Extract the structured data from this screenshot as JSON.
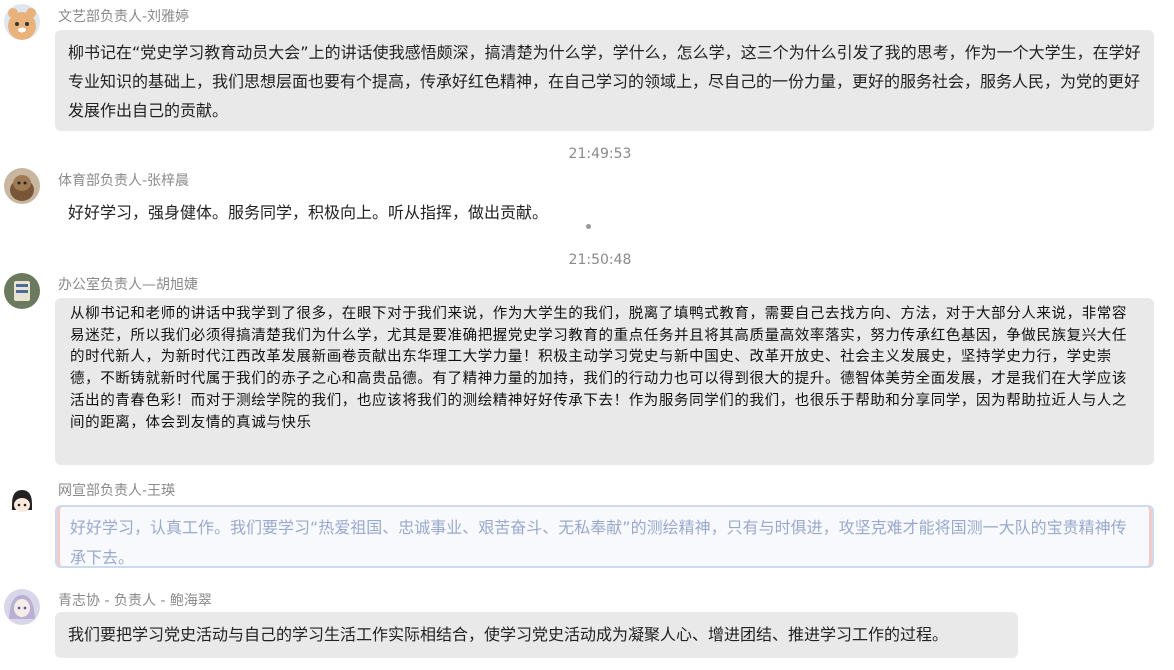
{
  "messages": [
    {
      "sender": "文艺部负责人-刘雅婷",
      "text": "柳书记在“党史学习教育动员大会”上的讲话使我感悟颇深，搞清楚为什么学，学什么，怎么学，这三个为什么引发了我的思考，作为一个大学生，在学好专业知识的基础上，我们思想层面也要有个提高，传承好红色精神，在自己学习的领域上，尽自己的一份力量，更好的服务社会，服务人民，为党的更好发展作出自己的贡献。"
    },
    {
      "sender": "体育部负责人-张梓晨",
      "text": "好好学习，强身健体。服务同学，积极向上。听从指挥，做出贡献。"
    },
    {
      "sender": "办公室负责人—胡旭婕",
      "text": "从柳书记和老师的讲话中我学到了很多，在眼下对于我们来说，作为大学生的我们，脱离了填鸭式教育，需要自己去找方向、方法，对于大部分人来说，非常容易迷茫，所以我们必须得搞清楚我们为什么学，尤其是要准确把握党史学习教育的重点任务并且将其高质量高效率落实，努力传承红色基因，争做民族复兴大任的时代新人，为新时代江西改革发展新画卷贡献出东华理工大学力量！积极主动学习党史与新中国史、改革开放史、社会主义发展史，坚持学史力行，学史崇德，不断铸就新时代属于我们的赤子之心和高贵品德。有了精神力量的加持，我们的行动力也可以得到很大的提升。德智体美劳全面发展，才是我们在大学应该活出的青春色彩！而对于测绘学院的我们，也应该将我们的测绘精神好好传承下去！作为服务同学们的我们，也很乐于帮助和分享同学，因为帮助拉近人与人之间的距离，体会到友情的真诚与快乐"
    },
    {
      "sender": "网宣部负责人-王瑛",
      "text": "好好学习，认真工作。我们要学习“热爱祖国、忠诚事业、艰苦奋斗、无私奉献”的测绘精神，只有与时俱进，攻坚克难才能将国测一大队的宝贵精神传承下去。"
    },
    {
      "sender": "青志协 - 负责人 - 鲍海翠",
      "text": "我们要把学习党史活动与自己的学习生活工作实际相结合，使学习党史活动成为凝聚人心、增进团结、推进学习工作的过程。"
    }
  ],
  "timestamps": [
    "21:49:53",
    "21:50:48"
  ],
  "colors": {
    "bubble": "#e9e9e9",
    "name": "#8a8a8a",
    "special_text": "#9aa9cc",
    "special_border": "#cdd9ee"
  }
}
